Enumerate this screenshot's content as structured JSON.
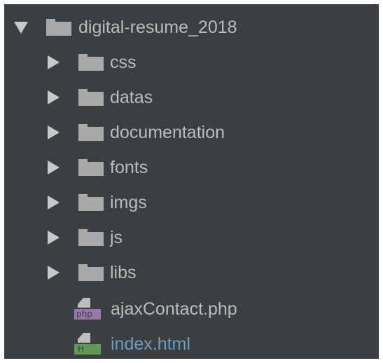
{
  "root": {
    "label": "digital-resume_2018",
    "expanded": true,
    "arrow_icon": "expanded-arrow-icon",
    "icon": "folder-icon"
  },
  "children": [
    {
      "label": "css",
      "kind": "folder",
      "arrow_icon": "collapsed-arrow-icon",
      "icon": "folder-icon"
    },
    {
      "label": "datas",
      "kind": "folder",
      "arrow_icon": "collapsed-arrow-icon",
      "icon": "folder-icon"
    },
    {
      "label": "documentation",
      "kind": "folder",
      "arrow_icon": "collapsed-arrow-icon",
      "icon": "folder-icon"
    },
    {
      "label": "fonts",
      "kind": "folder",
      "arrow_icon": "collapsed-arrow-icon",
      "icon": "folder-icon"
    },
    {
      "label": "imgs",
      "kind": "folder",
      "arrow_icon": "collapsed-arrow-icon",
      "icon": "folder-icon"
    },
    {
      "label": "js",
      "kind": "folder",
      "arrow_icon": "collapsed-arrow-icon",
      "icon": "folder-icon"
    },
    {
      "label": "libs",
      "kind": "folder",
      "arrow_icon": "collapsed-arrow-icon",
      "icon": "folder-icon"
    },
    {
      "label": "ajaxContact.php",
      "kind": "file",
      "icon": "php-file-icon",
      "badge": "php",
      "badge_color": "#9876aa"
    },
    {
      "label": "index.html",
      "kind": "file",
      "icon": "html-file-icon",
      "badge": "H",
      "badge_color": "#629755",
      "label_color": "#6d9cbe"
    }
  ],
  "colors": {
    "background": "#3c3f41",
    "text": "#bbbbbb",
    "folder": "#a9a9a9",
    "arrow": "#c9c9c9",
    "html_text": "#6d9cbe"
  }
}
